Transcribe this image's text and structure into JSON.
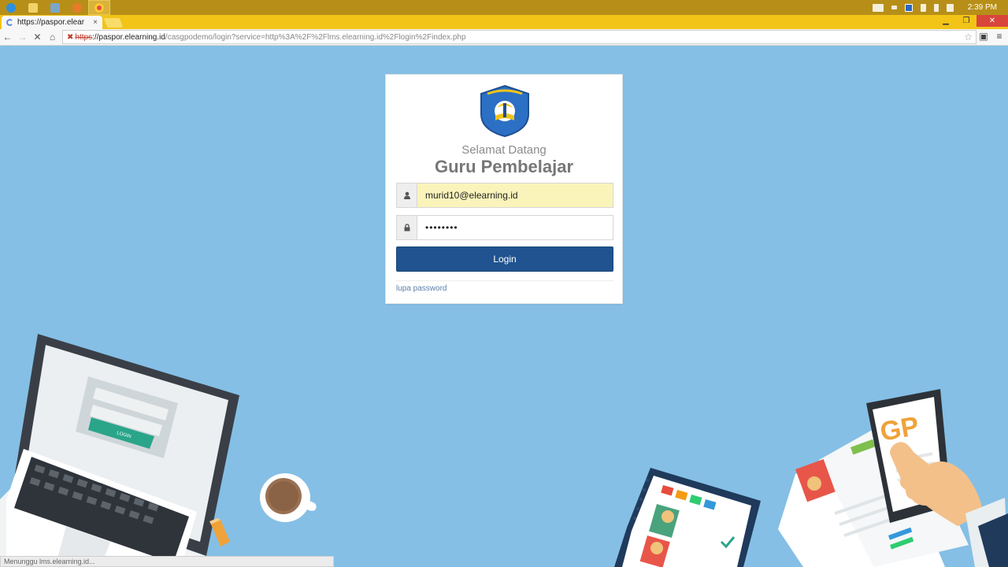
{
  "taskbar": {
    "clock": "2:39 PM"
  },
  "browser": {
    "tab_title": "https://paspor.elear",
    "tab_close": "×",
    "url_scheme": "https",
    "url_host": "://paspor.elearning.id",
    "url_path": "/casgpodemo/login?service=http%3A%2F%2Flms.elearning.id%2Flogin%2Findex.php",
    "status_text": "Menunggu lms.elearning.id..."
  },
  "login": {
    "welcome": "Selamat Datang",
    "headline": "Guru Pembelajar",
    "username_value": "murid10@elearning.id",
    "password_value": "••••••••",
    "button_label": "Login",
    "forgot_link": "lupa password"
  },
  "illustration": {
    "screen_button_label": "LOGIN",
    "phone_logo": "GP"
  },
  "colors": {
    "background": "#85bfe5",
    "button": "#20538f",
    "taskbar": "#b78f18",
    "tabstrip": "#f2c418",
    "autofill": "#faf4bb"
  }
}
